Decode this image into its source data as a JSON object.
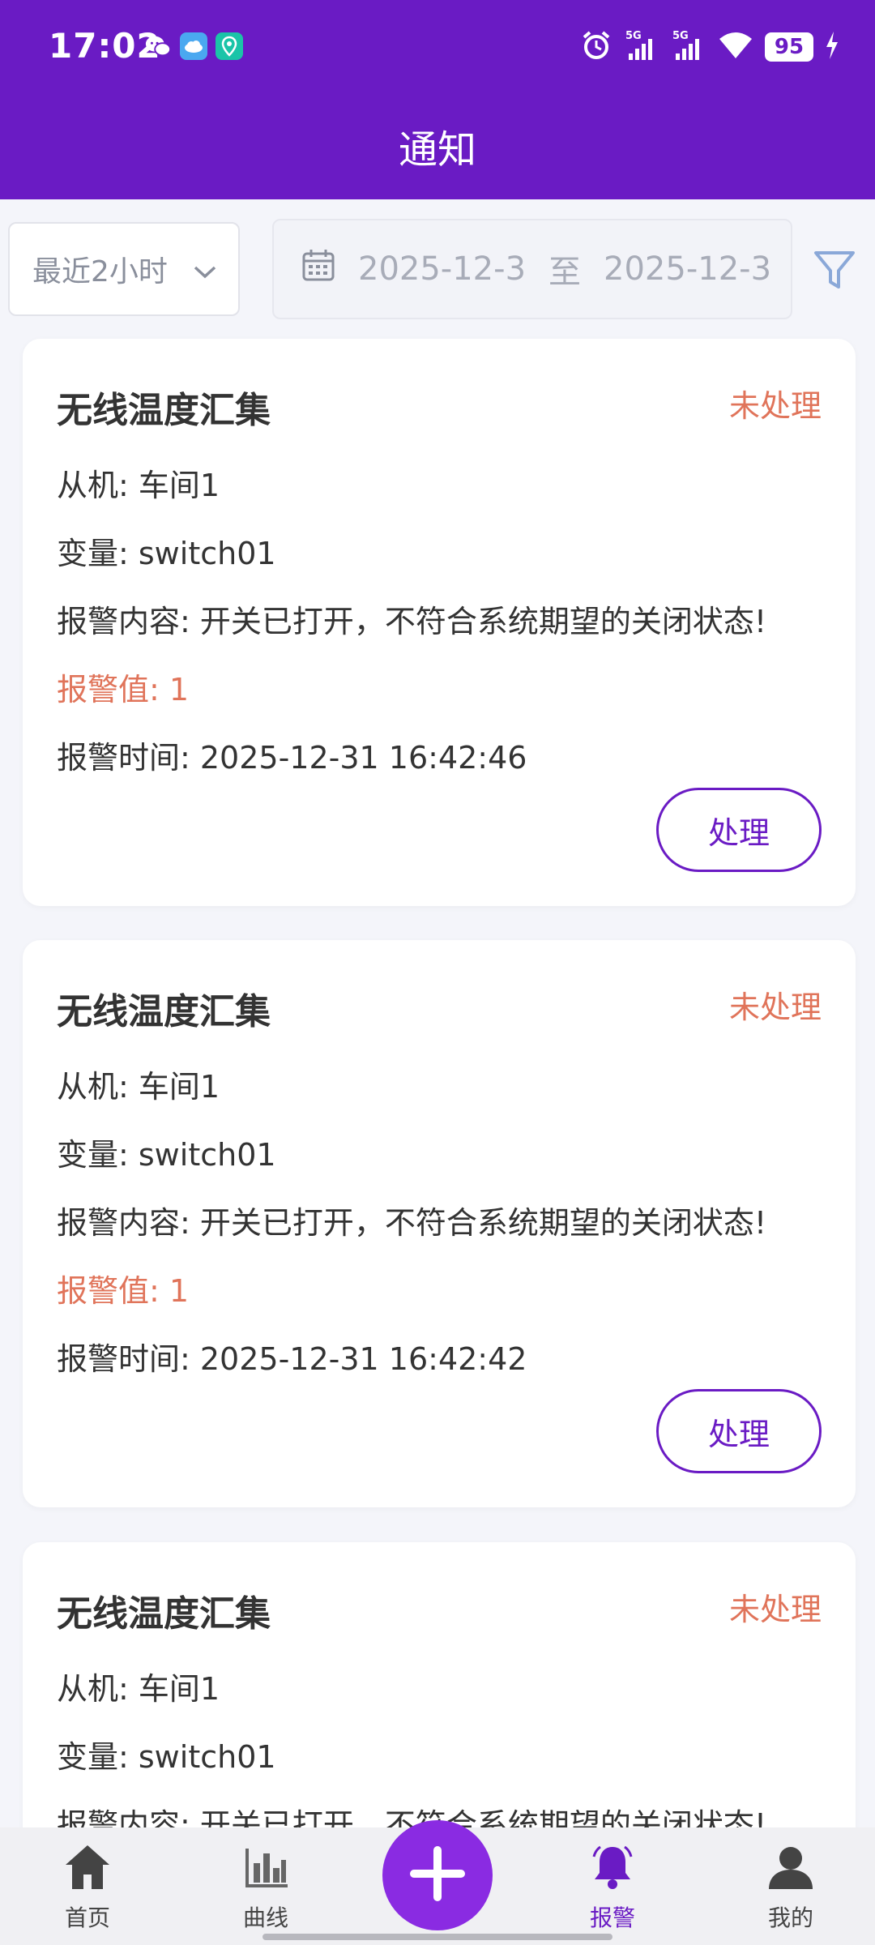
{
  "status_bar": {
    "time": "17:02",
    "battery": "95",
    "icons": [
      "wechat-icon",
      "cloud-app-icon",
      "location-app-icon",
      "alarm-clock-icon",
      "signal-5g-icon",
      "signal-5g-icon",
      "wifi-icon",
      "charging-icon"
    ]
  },
  "header": {
    "title": "通知"
  },
  "filter": {
    "time_range": "最近2小时",
    "start_date": "2025-12-3",
    "separator": "至",
    "end_date": "2025-12-3"
  },
  "cards": [
    {
      "title": "无线温度汇集",
      "status": "未处理",
      "slave": "从机: 车间1",
      "variable": "变量: switch01",
      "content": "报警内容: 开关已打开，不符合系统期望的关闭状态!",
      "value": "报警值: 1",
      "time": "报警时间: 2025-12-31 16:42:46",
      "button": "处理"
    },
    {
      "title": "无线温度汇集",
      "status": "未处理",
      "slave": "从机: 车间1",
      "variable": "变量: switch01",
      "content": "报警内容: 开关已打开，不符合系统期望的关闭状态!",
      "value": "报警值: 1",
      "time": "报警时间: 2025-12-31 16:42:42",
      "button": "处理"
    },
    {
      "title": "无线温度汇集",
      "status": "未处理",
      "slave": "从机: 车间1",
      "variable": "变量: switch01",
      "content": "报警内容: 开关已打开，不符合系统期望的关闭状态!"
    }
  ],
  "nav": {
    "home": "首页",
    "curve": "曲线",
    "alarm": "报警",
    "mine": "我的"
  },
  "colors": {
    "brand": "#6a1bc4",
    "fab": "#8a2be2",
    "status_unhandled": "#e0745a"
  }
}
